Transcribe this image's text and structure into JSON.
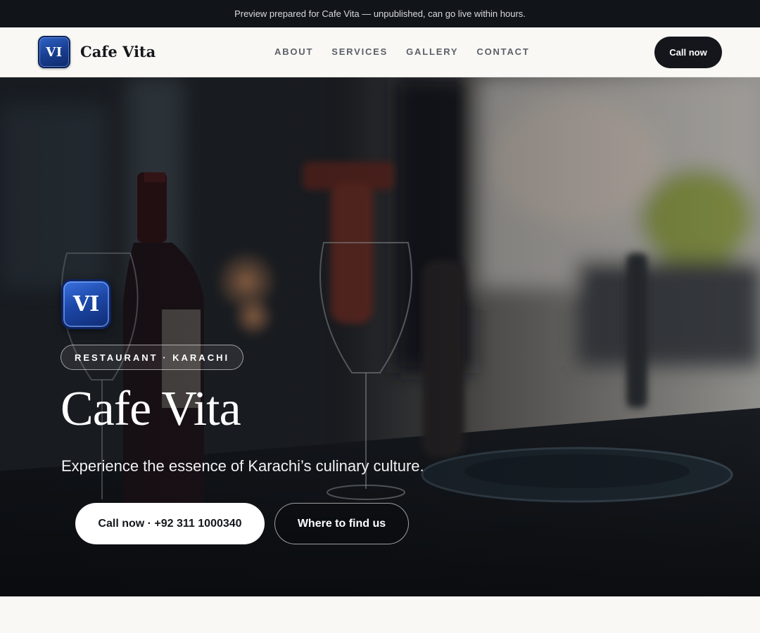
{
  "announcement": {
    "text": "Preview prepared for Cafe Vita — unpublished, can go live within hours."
  },
  "header": {
    "logo_initials": "VI",
    "brand_name": "Cafe Vita",
    "nav": [
      {
        "label": "ABOUT"
      },
      {
        "label": "SERVICES"
      },
      {
        "label": "GALLERY"
      },
      {
        "label": "CONTACT"
      }
    ],
    "cta_label": "Call now"
  },
  "hero": {
    "badge_initials": "VI",
    "category": "RESTAURANT · KARACHI",
    "title": "Cafe Vita",
    "tagline": "Experience the essence of Karachi’s culinary culture.",
    "primary_button": "Call now · +92 311 1000340",
    "secondary_button": "Where to find us"
  },
  "colors": {
    "topbar_bg": "#111419",
    "page_bg": "#f9f8f5",
    "dark_button": "#14161b",
    "badge_blue": "#1d48a8"
  }
}
